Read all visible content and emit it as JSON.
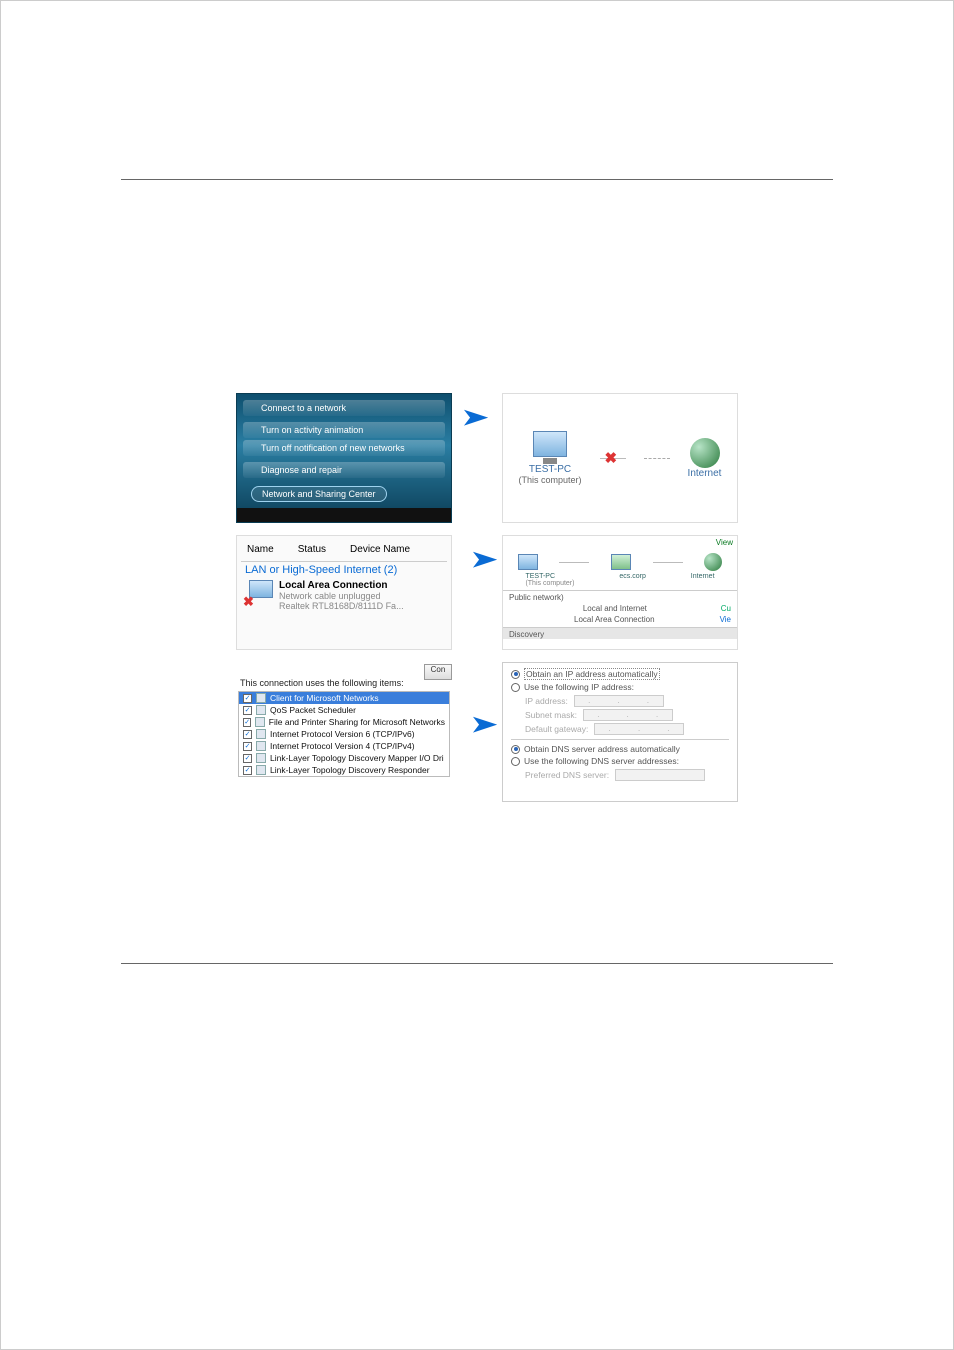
{
  "vista_menu": {
    "items": [
      "Connect to a network",
      "Turn on activity animation",
      "Turn off notification of new networks",
      "Diagnose and repair"
    ],
    "highlighted": "Network and Sharing Center"
  },
  "network_map": {
    "pc_name": "TEST-PC",
    "pc_sub": "(This computer)",
    "internet_label": "Internet"
  },
  "lan_panel": {
    "col_name": "Name",
    "col_status": "Status",
    "col_device": "Device Name",
    "group": "LAN or High-Speed Internet (2)",
    "conn_name": "Local Area Connection",
    "conn_status": "Network cable unplugged",
    "conn_device": "Realtek RTL8168D/8111D Fa..."
  },
  "map2": {
    "view_label": "View",
    "pc_name": "TEST-PC",
    "pc_sub": "(This computer)",
    "gw": "ecs.corp",
    "net": "Internet",
    "section": "Public network)",
    "access_line": "Local and Internet",
    "conn_line": "Local Area Connection",
    "cu": "Cu",
    "vie": "Vie",
    "discovery": "Discovery"
  },
  "conn_items": {
    "button": "Con",
    "title": "This connection uses the following items:",
    "items": [
      "Client for Microsoft Networks",
      "QoS Packet Scheduler",
      "File and Printer Sharing for Microsoft Networks",
      "Internet Protocol Version 6 (TCP/IPv6)",
      "Internet Protocol Version 4 (TCP/IPv4)",
      "Link-Layer Topology Discovery Mapper I/O Dri",
      "Link-Layer Topology Discovery Responder"
    ]
  },
  "ip_settings": {
    "auto_ip": "Obtain an IP address automatically",
    "use_ip": "Use the following IP address:",
    "ip_addr": "IP address:",
    "subnet": "Subnet mask:",
    "gateway": "Default gateway:",
    "auto_dns": "Obtain DNS server address automatically",
    "use_dns": "Use the following DNS server addresses:",
    "pref_dns": "Preferred DNS server:"
  }
}
